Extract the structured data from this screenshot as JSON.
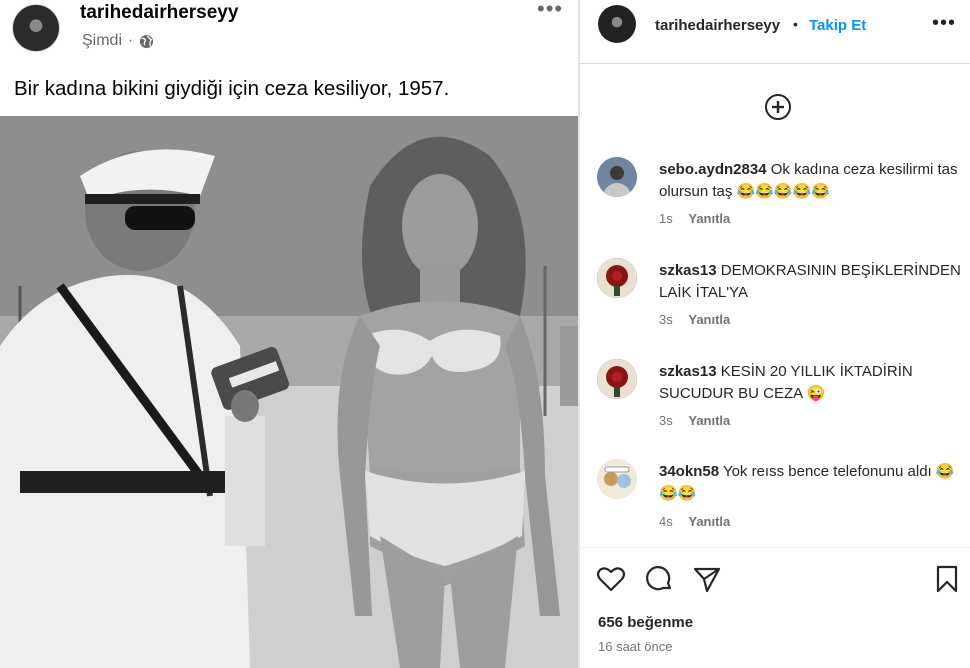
{
  "fb_post": {
    "author": "tarihedairherseyy",
    "time": "Şimdi",
    "separator": "·",
    "more": "•••",
    "caption": "Bir kadına bikini giydiği için ceza kesiliyor, 1957."
  },
  "ig_sidebar": {
    "header": {
      "username": "tarihedairherseyy",
      "dot": "•",
      "follow_label": "Takip Et",
      "more": "•••"
    },
    "comments": [
      {
        "user": "sebo.aydn2834",
        "text": "Ok kadına ceza kesilirmi tas olursun taş 😂😂😂😂😂",
        "age": "1s",
        "reply": "Yanıtla",
        "avatar_color": "#7a8fa8"
      },
      {
        "user": "szkas13",
        "text": "DEMOKRASININ BEŞİKLERİNDEN LAİK İTAL'YA",
        "age": "3s",
        "reply": "Yanıtla",
        "avatar_color": "#7a1a1a"
      },
      {
        "user": "szkas13",
        "text": "KESİN 20 YILLIK İKTADİRİN SUCUDUR BU CEZA 😜",
        "age": "3s",
        "reply": "Yanıtla",
        "avatar_color": "#7a1a1a"
      },
      {
        "user": "34okn58",
        "text": "Yok reıss bence telefonunu aldı 😂😂😂",
        "age": "4s",
        "reply": "Yanıtla",
        "avatar_color": "#e9d9b5"
      }
    ],
    "likes": "656 beğenme",
    "posted_ago": "16 saat önce"
  }
}
